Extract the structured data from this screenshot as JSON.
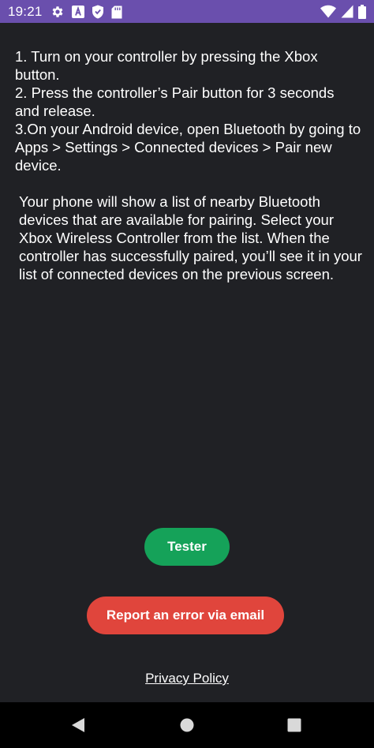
{
  "status_bar": {
    "time": "19:21",
    "left_icons": [
      "gear-icon",
      "font-icon",
      "shield-icon",
      "sd-card-icon"
    ],
    "right_icons": [
      "wifi-icon",
      "cell-signal-icon",
      "battery-icon"
    ],
    "background": "#6a4fad"
  },
  "instructions": {
    "step1": "1. Turn on your controller by pressing the Xbox button.",
    "step2": "2. Press the controller’s Pair button for 3 seconds and release.",
    "step3": "3.On your Android device, open Bluetooth by going to Apps > Settings > Connected devices > Pair new device.",
    "note": "Your phone will show a list of nearby Bluetooth devices that are available for pairing. Select your Xbox Wireless Controller from the list. When the controller has successfully paired, you’ll see it in your list of connected devices on the previous screen."
  },
  "buttons": {
    "tester_label": "Tester",
    "report_label": "Report an error via email"
  },
  "links": {
    "privacy_label": "Privacy Policy"
  },
  "nav_bar": {
    "icons": [
      "back-icon",
      "home-icon",
      "recents-icon"
    ]
  },
  "colors": {
    "background": "#202125",
    "tester_button": "#15a259",
    "report_button": "#e0453c",
    "status_bar": "#6a4fad"
  }
}
